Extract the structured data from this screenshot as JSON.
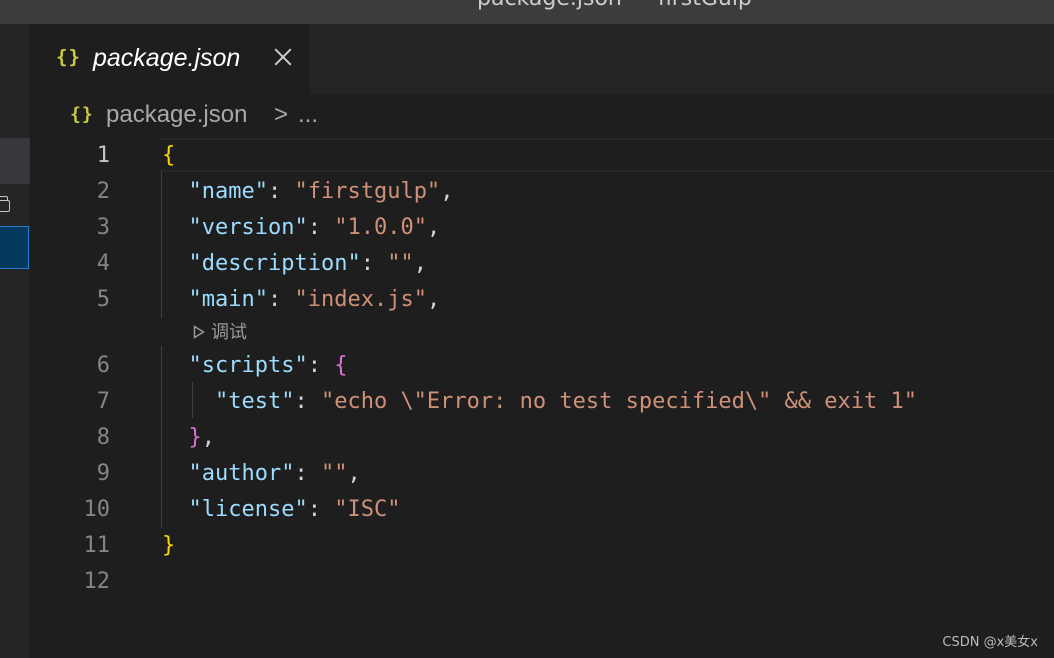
{
  "window": {
    "title": "package.json — firstGulp"
  },
  "tab": {
    "icon": "{}",
    "icon_name": "json-braces-icon",
    "label": "package.json",
    "close_icon": "close-icon"
  },
  "breadcrumb": {
    "icon": "{}",
    "file": "package.json",
    "separator": ">",
    "more": "..."
  },
  "editor": {
    "line_numbers": [
      "1",
      "2",
      "3",
      "4",
      "5",
      "6",
      "7",
      "8",
      "9",
      "10",
      "11",
      "12"
    ],
    "codelens": "调试",
    "lines": [
      {
        "parts": [
          {
            "t": "{",
            "c": "b1"
          }
        ]
      },
      {
        "parts": [
          {
            "t": "  "
          },
          {
            "t": "\"name\"",
            "c": "k"
          },
          {
            "t": ": "
          },
          {
            "t": "\"firstgulp\"",
            "c": "s"
          },
          {
            "t": ","
          }
        ]
      },
      {
        "parts": [
          {
            "t": "  "
          },
          {
            "t": "\"version\"",
            "c": "k"
          },
          {
            "t": ": "
          },
          {
            "t": "\"1.0.0\"",
            "c": "s"
          },
          {
            "t": ","
          }
        ]
      },
      {
        "parts": [
          {
            "t": "  "
          },
          {
            "t": "\"description\"",
            "c": "k"
          },
          {
            "t": ": "
          },
          {
            "t": "\"\"",
            "c": "s"
          },
          {
            "t": ","
          }
        ]
      },
      {
        "parts": [
          {
            "t": "  "
          },
          {
            "t": "\"main\"",
            "c": "k"
          },
          {
            "t": ": "
          },
          {
            "t": "\"index.js\"",
            "c": "s"
          },
          {
            "t": ","
          }
        ]
      },
      {
        "parts": [
          {
            "t": "  "
          },
          {
            "t": "\"scripts\"",
            "c": "k"
          },
          {
            "t": ": "
          },
          {
            "t": "{",
            "c": "b2"
          }
        ]
      },
      {
        "parts": [
          {
            "t": "    "
          },
          {
            "t": "\"test\"",
            "c": "k"
          },
          {
            "t": ": "
          },
          {
            "t": "\"echo \\\"Error: no test specified\\\" && exit 1\"",
            "c": "s"
          }
        ]
      },
      {
        "parts": [
          {
            "t": "  "
          },
          {
            "t": "}",
            "c": "b2"
          },
          {
            "t": ","
          }
        ]
      },
      {
        "parts": [
          {
            "t": "  "
          },
          {
            "t": "\"author\"",
            "c": "k"
          },
          {
            "t": ": "
          },
          {
            "t": "\"\"",
            "c": "s"
          },
          {
            "t": ","
          }
        ]
      },
      {
        "parts": [
          {
            "t": "  "
          },
          {
            "t": "\"license\"",
            "c": "k"
          },
          {
            "t": ": "
          },
          {
            "t": "\"ISC\"",
            "c": "s"
          }
        ]
      },
      {
        "parts": [
          {
            "t": "}",
            "c": "b1"
          }
        ]
      },
      {
        "parts": []
      }
    ]
  },
  "watermark": "CSDN @x美女x",
  "colors": {
    "background": "#1e1e1e",
    "json_key": "#9cdcfe",
    "json_string": "#ce9178",
    "bracket_level1": "#ffd700",
    "bracket_level2": "#da70d6",
    "json_icon": "#cbcb41"
  }
}
